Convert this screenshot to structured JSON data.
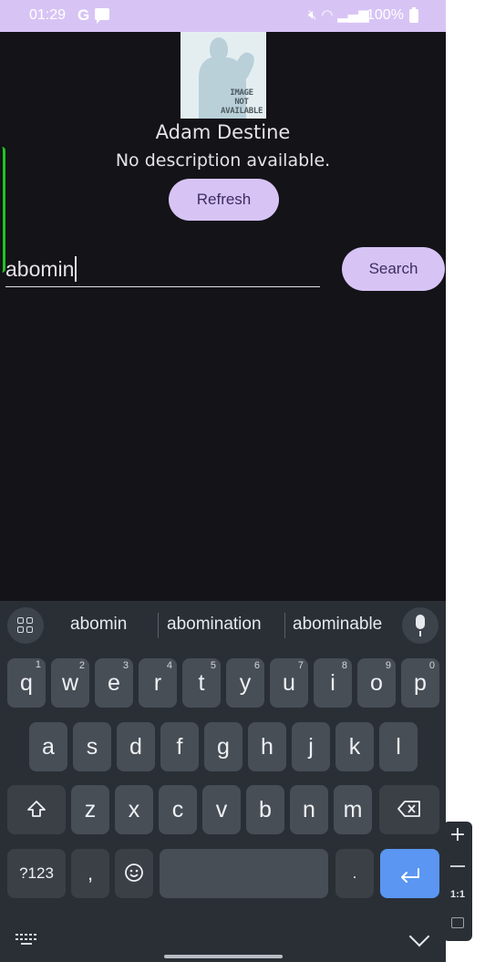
{
  "status_bar": {
    "time": "01:29",
    "carrier_icon": "G",
    "battery": "100%"
  },
  "profile": {
    "image_text": "IMAGE NOT AVAILABLE",
    "name": "Adam Destine",
    "description": "No description available.",
    "refresh_label": "Refresh"
  },
  "search": {
    "value": "abomin",
    "button_label": "Search"
  },
  "keyboard": {
    "suggestions": [
      "abomin",
      "abomination",
      "abominable"
    ],
    "row1": [
      {
        "k": "q",
        "h": "1"
      },
      {
        "k": "w",
        "h": "2"
      },
      {
        "k": "e",
        "h": "3"
      },
      {
        "k": "r",
        "h": "4"
      },
      {
        "k": "t",
        "h": "5"
      },
      {
        "k": "y",
        "h": "6"
      },
      {
        "k": "u",
        "h": "7"
      },
      {
        "k": "i",
        "h": "8"
      },
      {
        "k": "o",
        "h": "9"
      },
      {
        "k": "p",
        "h": "0"
      }
    ],
    "row2": [
      "a",
      "s",
      "d",
      "f",
      "g",
      "h",
      "j",
      "k",
      "l"
    ],
    "row3": [
      "z",
      "x",
      "c",
      "v",
      "b",
      "n",
      "m"
    ],
    "symbols_label": "?123",
    "comma": ",",
    "period": ".",
    "zoom_ratio": "1:1"
  },
  "colors": {
    "accent": "#d7c4f5",
    "background": "#131318",
    "enter_key": "#5a96f2"
  }
}
